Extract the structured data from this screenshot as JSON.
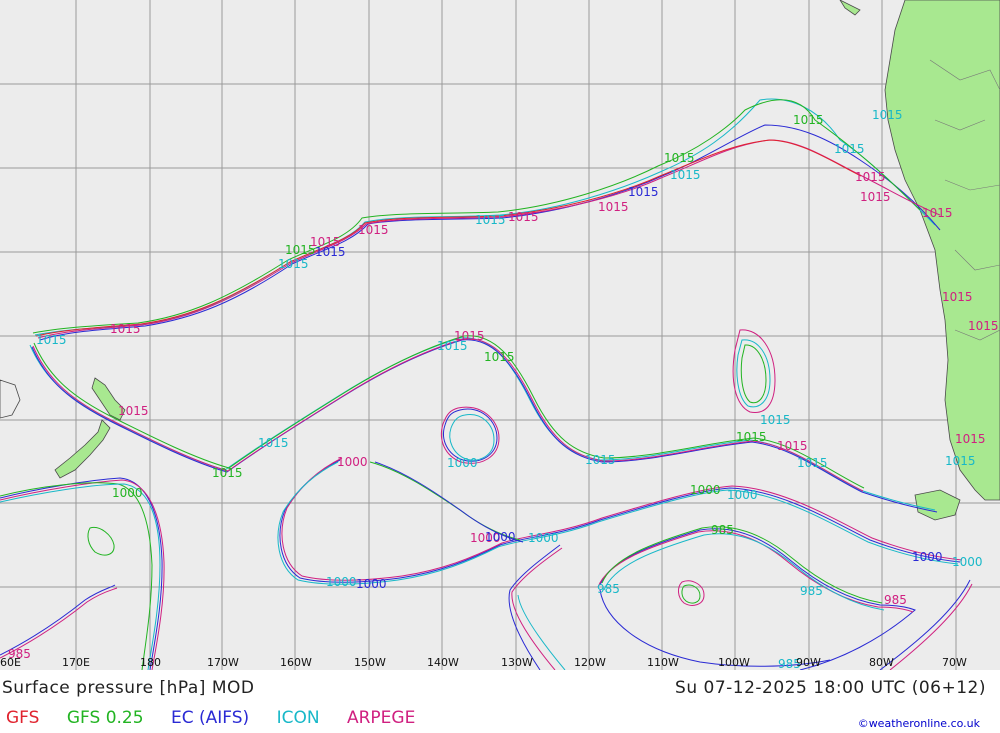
{
  "title": "Surface pressure [hPa] MOD",
  "datetime": "Su 07-12-2025 18:00 UTC (06+12)",
  "legend": [
    {
      "name": "GFS",
      "color": "#e0232e"
    },
    {
      "name": "GFS 0.25",
      "color": "#22b422"
    },
    {
      "name": "EC (AIFS)",
      "color": "#2a2ad4"
    },
    {
      "name": "ICON",
      "color": "#18b8c8"
    },
    {
      "name": "ARPEGE",
      "color": "#d02080"
    }
  ],
  "credit": "©weatheronline.co.uk",
  "longitude_labels": [
    "60E",
    "170E",
    "180",
    "170W",
    "160W",
    "150W",
    "140W",
    "130W",
    "120W",
    "110W",
    "100W",
    "90W",
    "80W",
    "70W"
  ],
  "isobar_labels": [
    "1015",
    "1000",
    "985"
  ],
  "colors": {
    "ocean": "#ececec",
    "land": "#a8e890",
    "grid": "#9a9a9a"
  }
}
